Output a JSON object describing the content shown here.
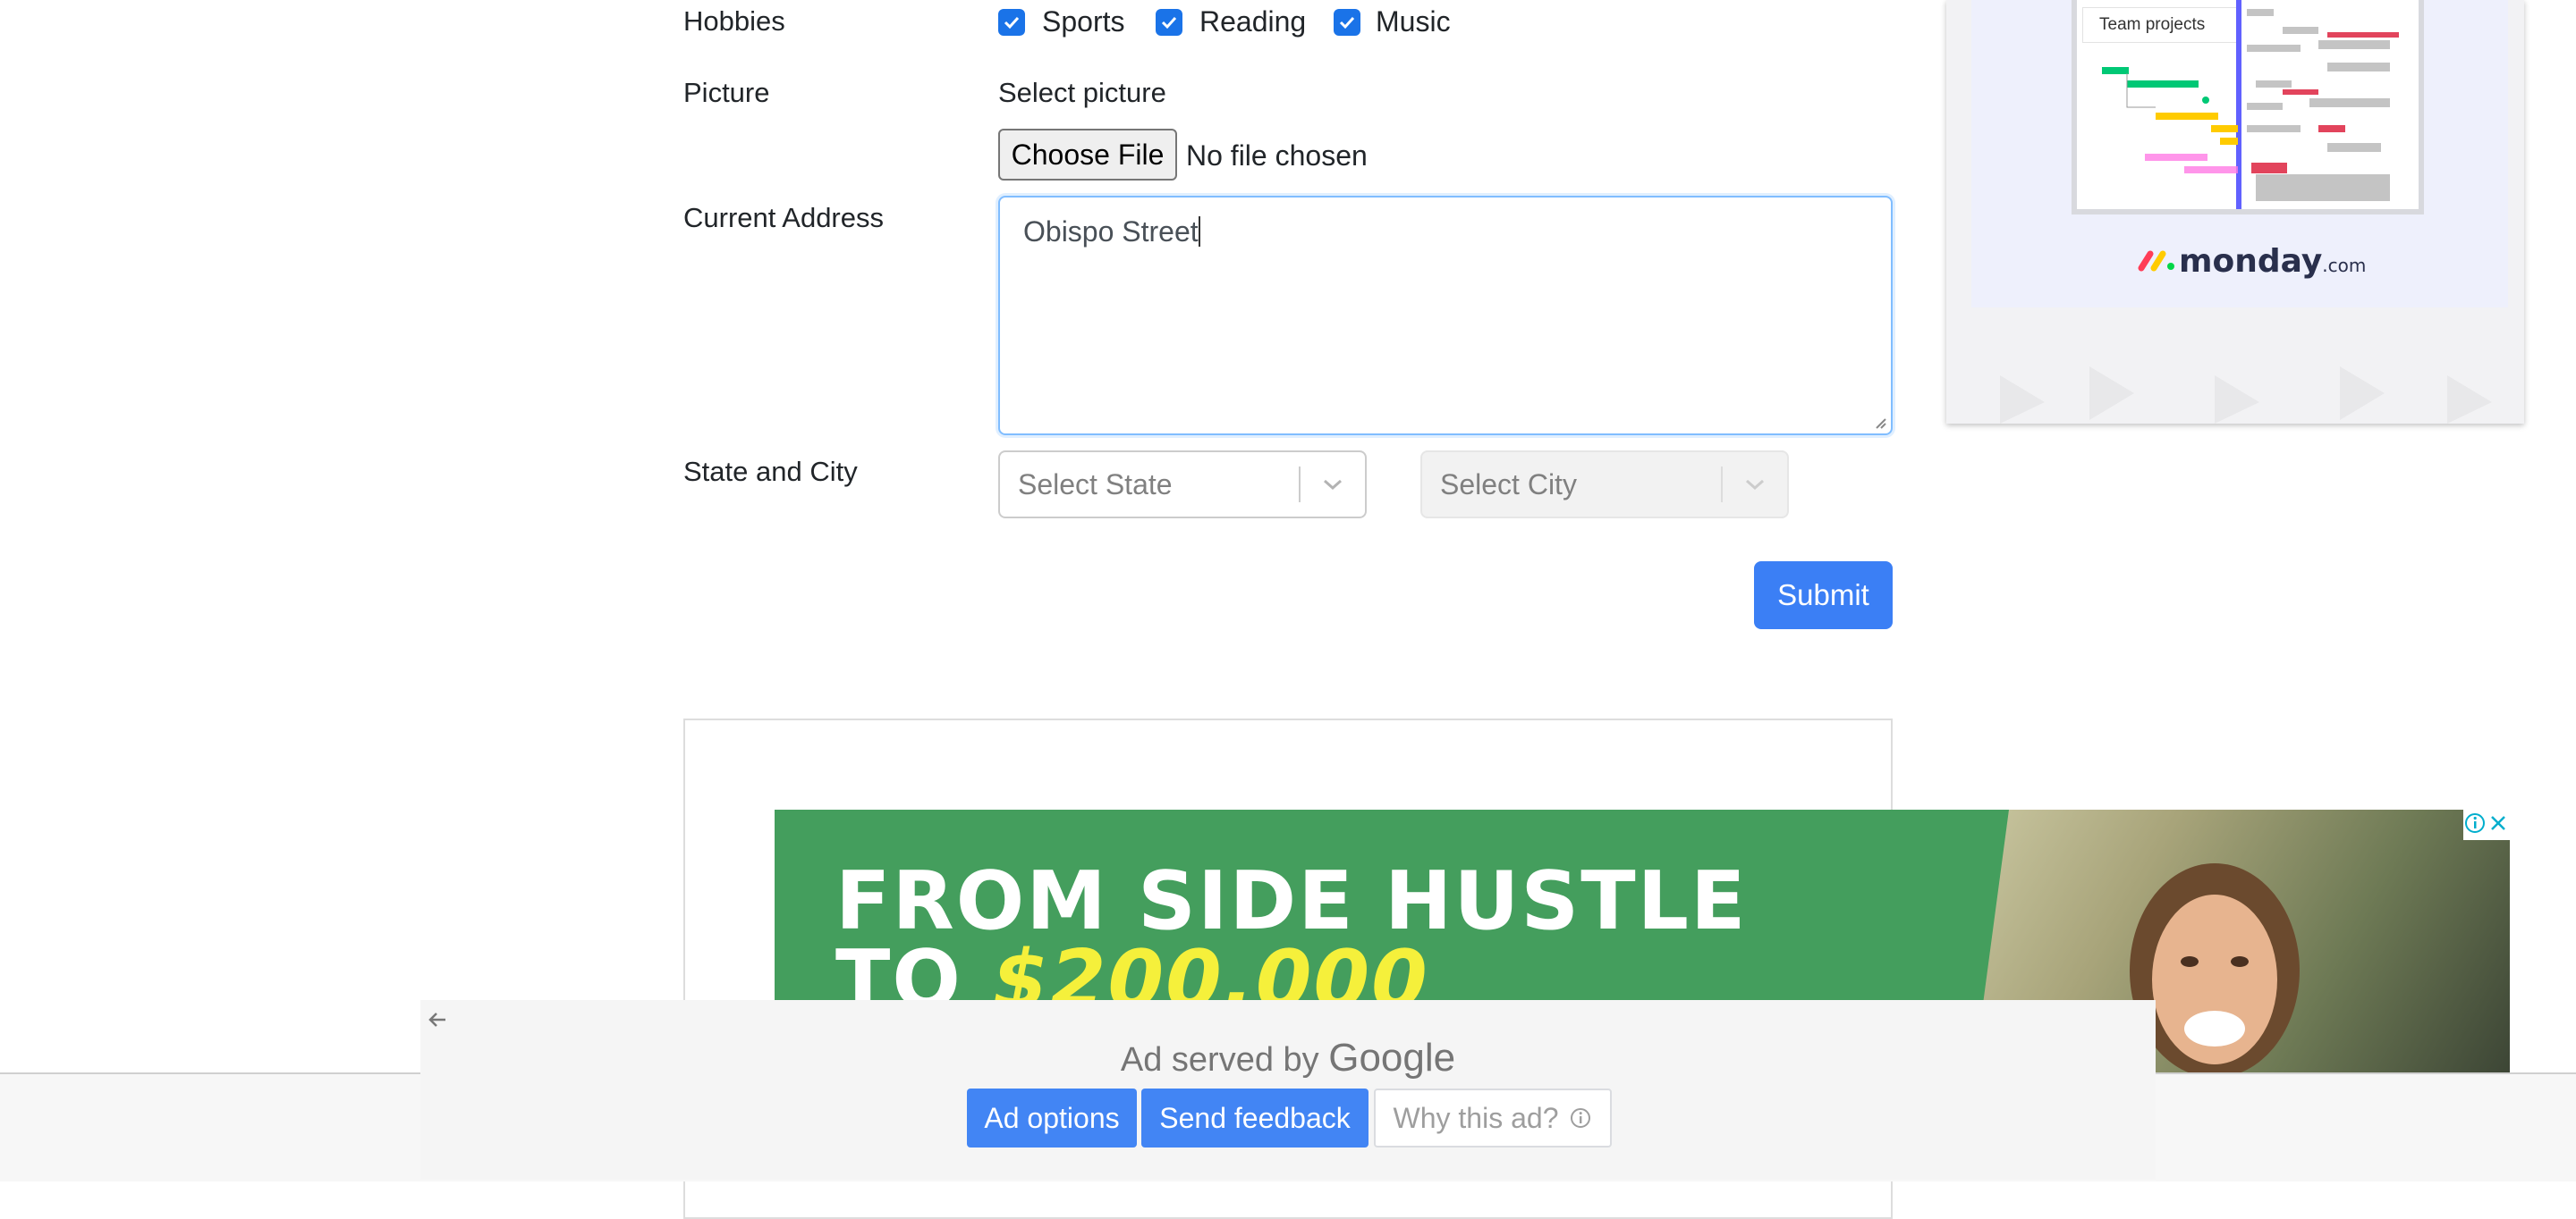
{
  "form": {
    "hobbies_label": "Hobbies",
    "hobbies": [
      {
        "label": "Sports",
        "checked": true
      },
      {
        "label": "Reading",
        "checked": true
      },
      {
        "label": "Music",
        "checked": true
      }
    ],
    "picture_label": "Picture",
    "picture_hint": "Select picture",
    "file_button": "Choose File",
    "file_status": "No file chosen",
    "address_label": "Current Address",
    "address_value": "Obispo Street",
    "state_city_label": "State and City",
    "state_placeholder": "Select State",
    "city_placeholder": "Select City",
    "submit": "Submit"
  },
  "side_ad": {
    "card_title": "Team projects",
    "brand": "monday",
    "brand_suffix": ".com"
  },
  "banner_ad": {
    "line1": "FROM SIDE HUSTLE",
    "line2_prefix": "TO ",
    "line2_amount": "$200,000"
  },
  "ad_overlay": {
    "served_by": "Ad served by",
    "google": "Google",
    "ad_options": "Ad options",
    "send_feedback": "Send feedback",
    "why_this_ad": "Why this ad?"
  },
  "colors": {
    "accent": "#3b7ff5",
    "checkbox": "#1a73e8",
    "banner_green": "#449e5d",
    "banner_yellow": "#f5f03b",
    "ad_button_blue": "#4285f4"
  }
}
